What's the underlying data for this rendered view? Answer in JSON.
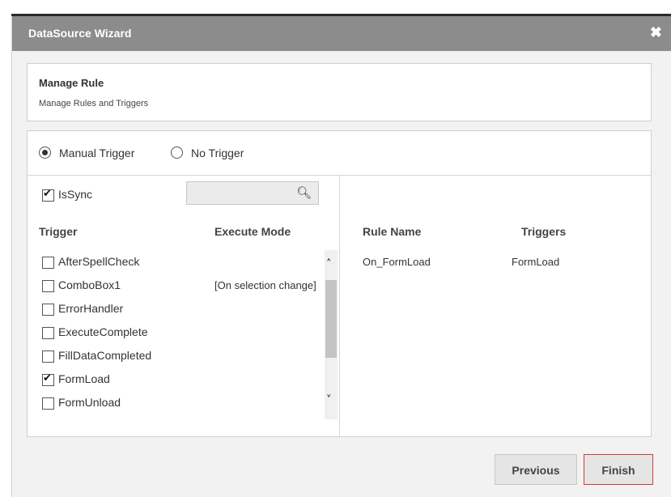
{
  "dialog": {
    "title": "DataSource Wizard",
    "close_glyph": "✖"
  },
  "rule_header": {
    "title": "Manage Rule",
    "subtitle": "Manage Rules and Triggers"
  },
  "trigger_mode": {
    "options": [
      {
        "label": "Manual Trigger",
        "selected": true
      },
      {
        "label": "No Trigger",
        "selected": false
      }
    ]
  },
  "is_sync": {
    "label": "IsSync",
    "checked": true
  },
  "search": {
    "value": "",
    "placeholder": "",
    "icon": "search-icon"
  },
  "trigger_table": {
    "headers": [
      "Trigger",
      "Execute Mode"
    ],
    "rows": [
      {
        "name": "AfterSpellCheck",
        "mode": "",
        "checked": false
      },
      {
        "name": "ComboBox1",
        "mode": "[On selection change]",
        "checked": false
      },
      {
        "name": "ErrorHandler",
        "mode": "",
        "checked": false
      },
      {
        "name": "ExecuteComplete",
        "mode": "",
        "checked": false
      },
      {
        "name": "FillDataCompleted",
        "mode": "",
        "checked": false
      },
      {
        "name": "FormLoad",
        "mode": "",
        "checked": true
      },
      {
        "name": "FormUnload",
        "mode": "",
        "checked": false
      }
    ]
  },
  "rule_table": {
    "headers": [
      "Rule Name",
      "Triggers"
    ],
    "rows": [
      {
        "rule": "On_FormLoad",
        "triggers": "FormLoad"
      }
    ]
  },
  "buttons": {
    "previous": "Previous",
    "finish": "Finish"
  }
}
